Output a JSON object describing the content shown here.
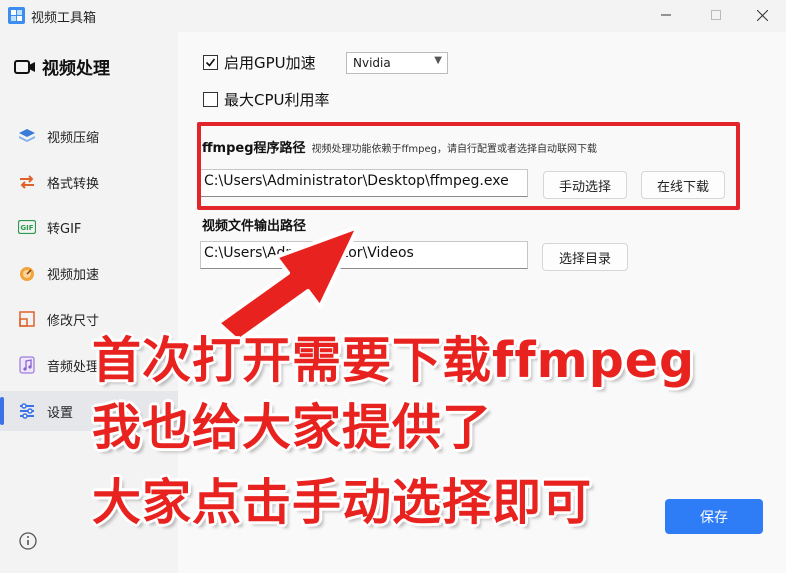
{
  "window": {
    "title": "视频工具箱"
  },
  "sidebar": {
    "header": "视频处理",
    "items": [
      {
        "label": "视频压缩",
        "icon": "layers-icon"
      },
      {
        "label": "格式转换",
        "icon": "convert-icon"
      },
      {
        "label": "转GIF",
        "icon": "gif-icon"
      },
      {
        "label": "视频加速",
        "icon": "speed-icon"
      },
      {
        "label": "修改尺寸",
        "icon": "resize-icon"
      },
      {
        "label": "音频处理",
        "icon": "music-icon"
      },
      {
        "label": "设置",
        "icon": "settings-icon",
        "active": true
      }
    ]
  },
  "settings": {
    "gpu_label": "启用GPU加速",
    "gpu_checked": true,
    "gpu_select": "Nvidia",
    "cpu_label": "最大CPU利用率",
    "cpu_checked": false,
    "ffmpeg_label": "ffmpeg程序路径",
    "ffmpeg_hint": "视频处理功能依赖于ffmpeg，请自行配置或者选择自动联网下载",
    "ffmpeg_path": "C:\\Users\\Administrator\\Desktop\\ffmpeg.exe",
    "manual_select": "手动选择",
    "online_download": "在线下载",
    "output_label": "视频文件输出路径",
    "output_path": "C:\\Users\\Administrator\\Videos",
    "select_dir": "选择目录",
    "save": "保存"
  },
  "overlay": {
    "line1": "首次打开需要下载ffmpeg",
    "line2": "我也给大家提供了",
    "line3": "大家点击手动选择即可"
  },
  "colors": {
    "accent": "#2e7cf6",
    "annotation_red": "#e8231f"
  }
}
